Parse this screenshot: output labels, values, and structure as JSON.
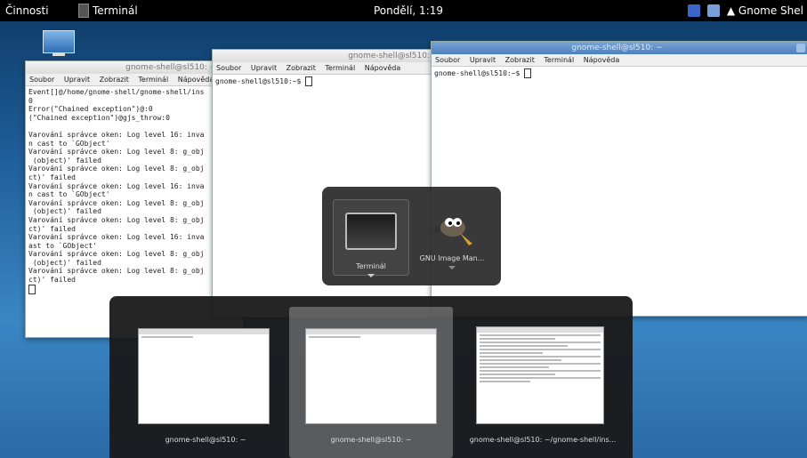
{
  "panel": {
    "activities": "Činnosti",
    "app_name": "Terminál",
    "clock": "Pondělí, 1:19",
    "user": "Gnome Shel"
  },
  "windows": {
    "w1": {
      "title": "gnome-shell@sl510: ~/gnor",
      "menu": [
        "Soubor",
        "Upravit",
        "Zobrazit",
        "Terminál",
        "Nápověda"
      ],
      "lines": [
        "Event[]@/home/gnome-shell/gnome-shell/ins",
        "0",
        "Error(\"Chained exception\")@:0",
        "(\"Chained exception\")@gjs_throw:0",
        "",
        "Varování správce oken: Log level 16: inva",
        "n cast to `GObject'",
        "Varování správce oken: Log level 8: g_obj",
        " (object)' failed",
        "Varování správce oken: Log level 8: g_obj",
        "ct)' failed",
        "Varování správce oken: Log level 16: inva",
        "n cast to `GObject'",
        "Varování správce oken: Log level 8: g_obj",
        " (object)' failed",
        "Varování správce oken: Log level 8: g_obj",
        "ct)' failed",
        "Varování správce oken: Log level 16: inva",
        "ast to `GObject'",
        "Varování správce oken: Log level 8: g_obj",
        " (object)' failed",
        "Varování správce oken: Log level 8: g_obj",
        "ct)' failed"
      ]
    },
    "w2": {
      "title": "gnome-shell@sl510:",
      "menu": [
        "Soubor",
        "Upravit",
        "Zobrazit",
        "Terminál",
        "Nápověda"
      ],
      "prompt": "gnome-shell@sl510:~$ "
    },
    "w3": {
      "title": "gnome-shell@sl510: ~",
      "menu": [
        "Soubor",
        "Upravit",
        "Zobrazit",
        "Terminál",
        "Nápověda"
      ],
      "prompt": "gnome-shell@sl510:~$ "
    }
  },
  "app_switcher": {
    "items": [
      {
        "label": "Terminál",
        "icon": "terminal-icon",
        "selected": true
      },
      {
        "label": "GNU Image Man...",
        "icon": "gimp-icon",
        "selected": false
      }
    ]
  },
  "window_switcher": {
    "items": [
      {
        "label": "gnome-shell@sl510: ~",
        "selected": false
      },
      {
        "label": "gnome-shell@sl510: ~",
        "selected": true
      },
      {
        "label": "gnome-shell@sl510: ~/gnome-shell/ins...",
        "selected": false
      }
    ]
  },
  "colors": {
    "panel": "#000000",
    "desktop": "#1f5f9a",
    "switcher": "#1e1e1e"
  }
}
